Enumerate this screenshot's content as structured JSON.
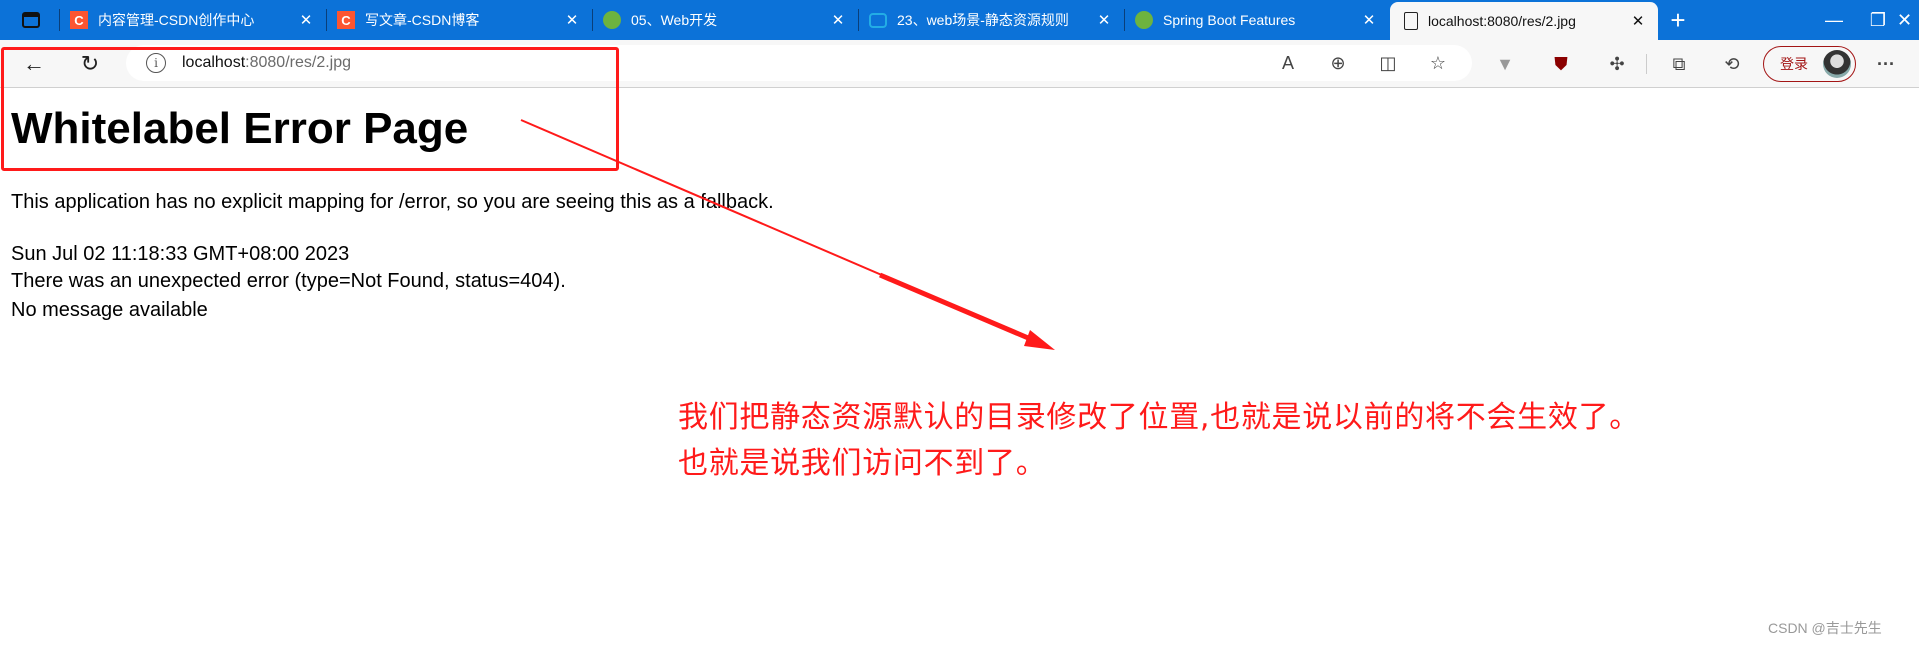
{
  "tabs": [
    {
      "label": "内容管理-CSDN创作中心",
      "icon": "csdn-icon",
      "color": "#fc5531"
    },
    {
      "label": "写文章-CSDN博客",
      "icon": "csdn-icon",
      "color": "#fc5531"
    },
    {
      "label": "05、Web开发",
      "icon": "leaf-icon",
      "color": "#6db33f"
    },
    {
      "label": "23、web场景-静态资源规则",
      "icon": "bilibili-icon",
      "color": "#23ade5"
    },
    {
      "label": "Spring Boot Features",
      "icon": "spring-icon",
      "color": "#6db33f"
    },
    {
      "label": "localhost:8080/res/2.jpg",
      "icon": "file-icon",
      "active": true
    }
  ],
  "address": {
    "host": "localhost",
    "rest": ":8080/res/2.jpg"
  },
  "toolbar": {
    "login_label": "登录"
  },
  "page": {
    "title": "Whitelabel Error Page",
    "line1": "This application has no explicit mapping for /error, so you are seeing this as a fallback.",
    "timestamp": "Sun Jul 02 11:18:33 GMT+08:00 2023",
    "error": "There was an unexpected error (type=Not Found, status=404).",
    "message": "No message available"
  },
  "annotation": {
    "line1": "我们把静态资源默认的目录修改了位置,也就是说以前的将不会生效了。",
    "line2": "也就是说我们访问不到了。",
    "color": "#ff1a1a"
  },
  "watermark": "CSDN @吉士先生"
}
